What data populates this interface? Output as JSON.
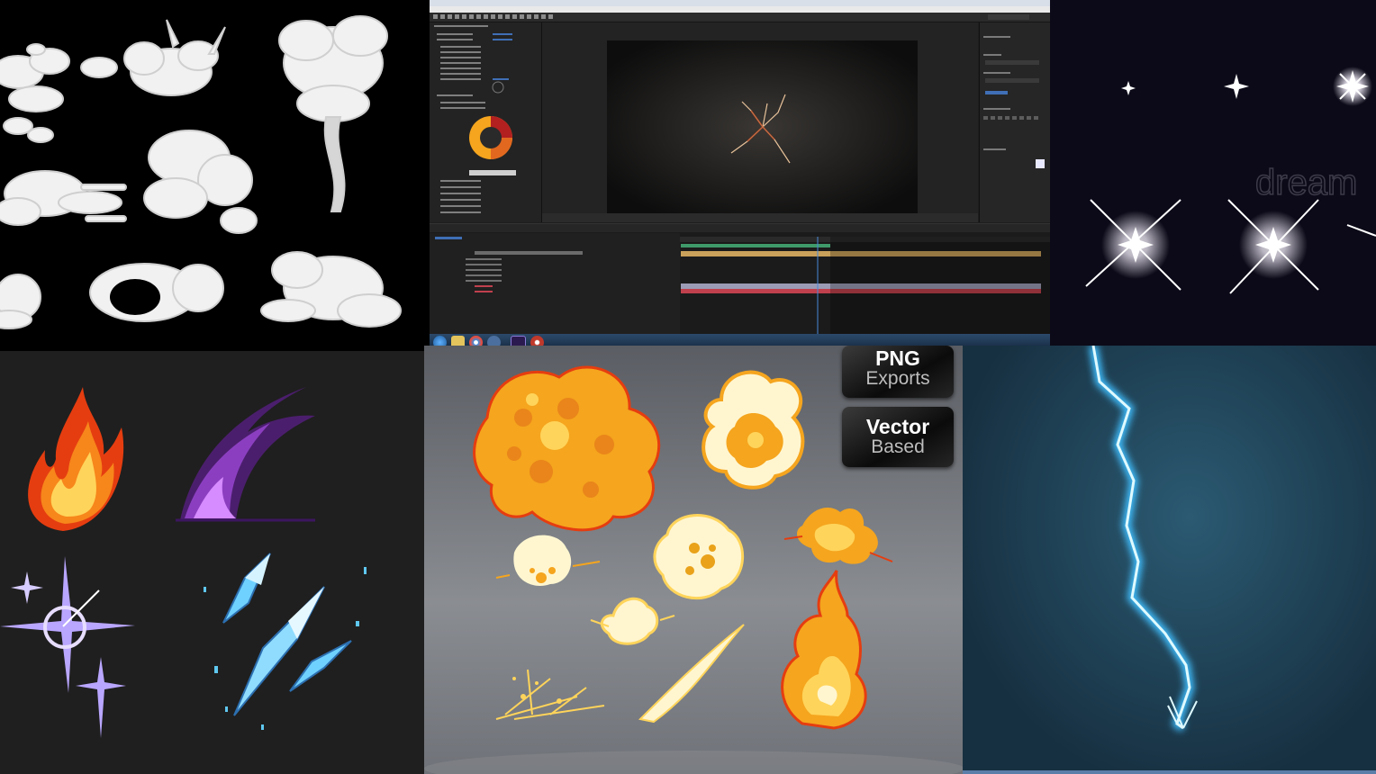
{
  "badges": {
    "png": {
      "line1": "PNG",
      "line2": "Exports"
    },
    "vector": {
      "line1": "Vector",
      "line2": "Based"
    }
  },
  "watermark": "dream",
  "colors": {
    "accent_orange": "#f5a51e",
    "fire_red": "#e53d10",
    "purple": "#a64fd8",
    "ice_blue": "#6fd1ff",
    "lightning": "#7fe6ff",
    "timeline_bar": "#c9a15a",
    "timeline_red": "#c0404d"
  },
  "icons": [
    "cloud-puff-icon",
    "sparkle-star-icon",
    "fire-icon",
    "crystal-icon",
    "explosion-icon",
    "lightning-bolt-icon",
    "start-orb-icon"
  ]
}
